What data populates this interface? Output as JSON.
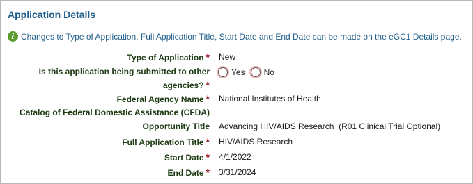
{
  "section": {
    "title": "Application Details",
    "notice": "Changes to Type of Application, Full Application Title, Start Date and End Date can be made on the eGC1 Details page."
  },
  "fields": {
    "type_of_application": {
      "label": "Type of Application",
      "required": "*",
      "value": "New"
    },
    "other_agencies": {
      "label_line1": "Is this application being submitted to other",
      "label_line2": "agencies?",
      "required": "*",
      "options": [
        "Yes",
        "No"
      ]
    },
    "federal_agency": {
      "label": "Federal Agency Name",
      "required": "*",
      "value": "National Institutes of Health"
    },
    "cfda": {
      "label": "Catalog of Federal Domestic Assistance (CFDA)"
    },
    "opportunity_title": {
      "label": "Opportunity Title",
      "value": "Advancing HIV/AIDS Research  (R01 Clinical Trial Optional)"
    },
    "full_title": {
      "label": "Full Application Title",
      "required": "*",
      "value": "HIV/AIDS Research"
    },
    "start_date": {
      "label": "Start Date",
      "required": "*",
      "value": "4/1/2022"
    },
    "end_date": {
      "label": "End Date",
      "required": "*",
      "value": "3/31/2024"
    }
  }
}
